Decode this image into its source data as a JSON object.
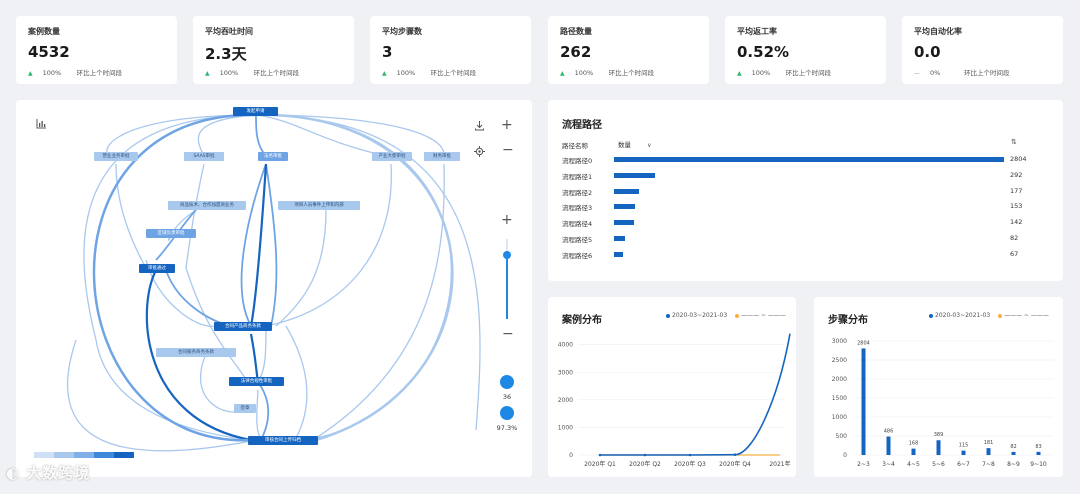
{
  "kpis": [
    {
      "title": "案例数量",
      "value": "4532",
      "pct": "100%",
      "compare": "环比上个时间段",
      "trend": "up"
    },
    {
      "title": "平均吞吐时间",
      "value": "2.3天",
      "pct": "100%",
      "compare": "环比上个时间段",
      "trend": "up"
    },
    {
      "title": "平均步骤数",
      "value": "3",
      "pct": "100%",
      "compare": "环比上个时间段",
      "trend": "up"
    },
    {
      "title": "路径数量",
      "value": "262",
      "pct": "100%",
      "compare": "环比上个时间段",
      "trend": "up"
    },
    {
      "title": "平均返工率",
      "value": "0.52%",
      "pct": "100%",
      "compare": "环比上个时间段",
      "trend": "up"
    },
    {
      "title": "平均自动化率",
      "value": "0.0",
      "pct": "0%",
      "compare": "环比上个时间段",
      "trend": "flat"
    }
  ],
  "process_map": {
    "nodes": {
      "start": "发起申请",
      "n1": "营业业务审批",
      "n2": "SAAS审批",
      "n3": "法务审批",
      "n4": "产业大使审批",
      "n5": "财务审批",
      "n6": "商品技术、合作加盟商业务",
      "n7": "项目人员事件上传和内部",
      "n8": "区域负责审批",
      "n9": "审批通过",
      "n10": "合同产品商务条款",
      "n11": "合同服务商务条款",
      "n12": "法律合规性审批",
      "n13": "签章",
      "end": "审核合同上传归档"
    },
    "zoom_slider_value": 0.8,
    "indicator1_label": "36",
    "indicator2_label": "97.3%",
    "icons": [
      "chart-icon",
      "download-icon",
      "plus-icon",
      "locate-icon",
      "minus-icon"
    ]
  },
  "paths": {
    "title": "流程路径",
    "col_name": "路径名称",
    "col_count": "数量",
    "sort_icon": "sort-icon",
    "rows": [
      {
        "name": "流程路径0",
        "value": 2804
      },
      {
        "name": "流程路径1",
        "value": 292
      },
      {
        "name": "流程路径2",
        "value": 177
      },
      {
        "name": "流程路径3",
        "value": 153
      },
      {
        "name": "流程路径4",
        "value": 142
      },
      {
        "name": "流程路径5",
        "value": 82
      },
      {
        "name": "流程路径6",
        "value": 67
      }
    ]
  },
  "case_dist": {
    "title": "案例分布",
    "legend1": "2020-03~2021-03",
    "legend1_color": "#1565c0",
    "legend2_color": "#f5b041",
    "legend2_suffix": "——— ~ ———"
  },
  "step_dist": {
    "title": "步骤分布",
    "legend1": "2020-03~2021-03",
    "legend1_color": "#1565c0",
    "legend2_color": "#f5b041",
    "legend2_suffix": "——— ~ ———"
  },
  "chart_data": [
    {
      "type": "line",
      "title": "案例分布",
      "categories": [
        "2020年 Q1",
        "2020年 Q2",
        "2020年 Q3",
        "2020年 Q4",
        "2021年"
      ],
      "series": [
        {
          "name": "2020-03~2021-03",
          "values": [
            0,
            0,
            0,
            10,
            4400
          ]
        },
        {
          "values": [
            0,
            0,
            0,
            0,
            0
          ]
        }
      ],
      "ylim": [
        0,
        4000
      ],
      "yticks": [
        0,
        1000,
        2000,
        3000,
        4000
      ],
      "grid": true
    },
    {
      "type": "bar",
      "title": "步骤分布",
      "categories": [
        "2~3",
        "3~4",
        "4~5",
        "5~6",
        "6~7",
        "7~8",
        "8~9",
        "9~10"
      ],
      "series": [
        {
          "name": "2020-03~2021-03",
          "values": [
            2804,
            486,
            168,
            389,
            115,
            181,
            82,
            83
          ]
        }
      ],
      "ylim": [
        0,
        3000
      ],
      "yticks": [
        0,
        500,
        1000,
        1500,
        2000,
        2500,
        3000
      ],
      "grid": true
    }
  ],
  "watermark": "大数跨境"
}
